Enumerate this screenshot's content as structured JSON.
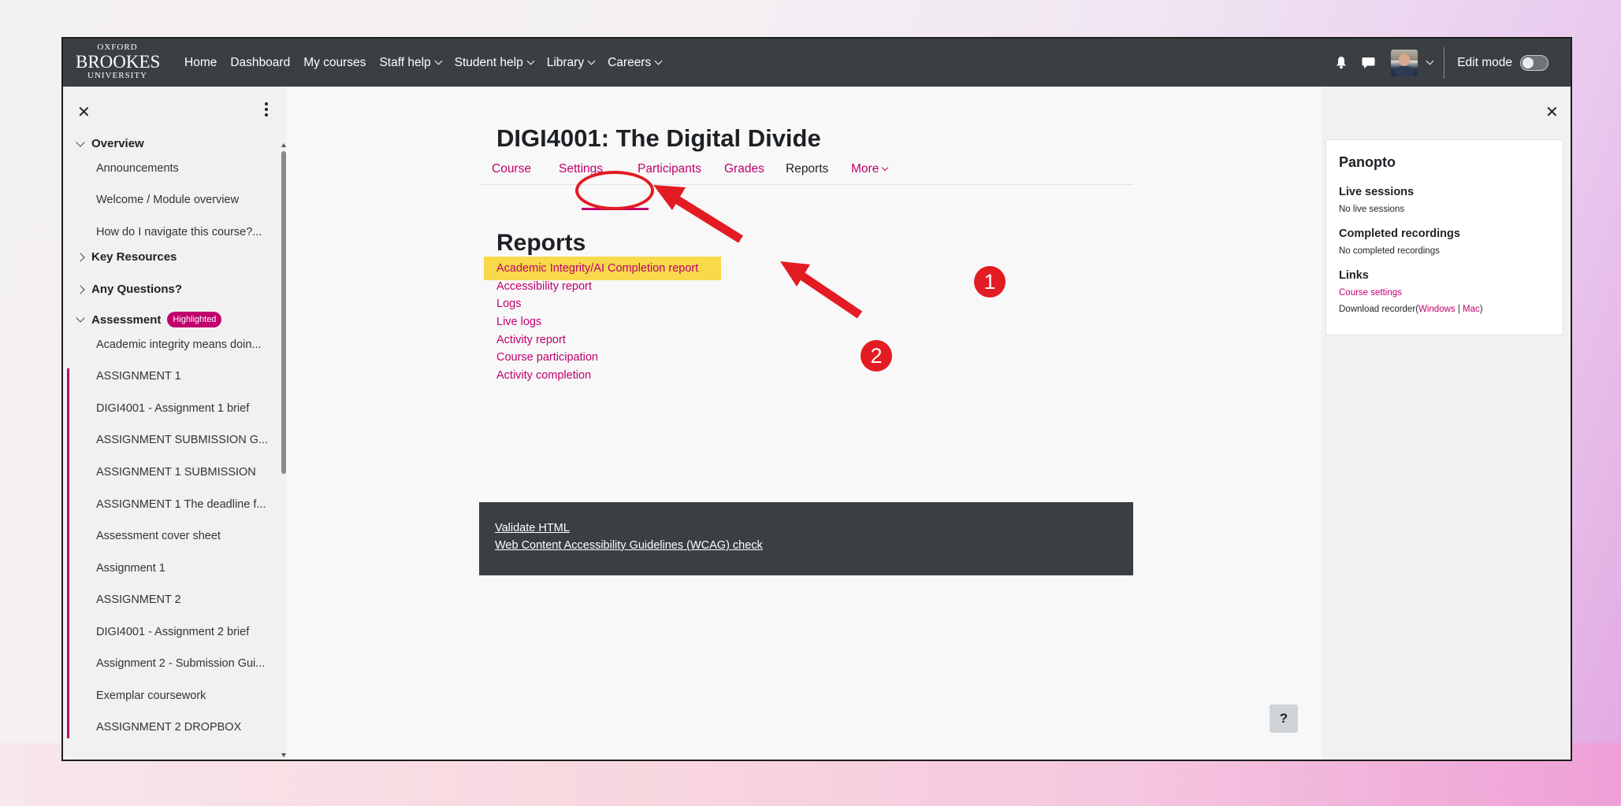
{
  "navbar": {
    "logo": {
      "line1": "OXFORD",
      "line2": "BROOKES",
      "line3": "UNIVERSITY"
    },
    "items": [
      {
        "label": "Home",
        "dropdown": false
      },
      {
        "label": "Dashboard",
        "dropdown": false
      },
      {
        "label": "My courses",
        "dropdown": false
      },
      {
        "label": "Staff help",
        "dropdown": true
      },
      {
        "label": "Student help",
        "dropdown": true
      },
      {
        "label": "Library",
        "dropdown": true
      },
      {
        "label": "Careers",
        "dropdown": true
      }
    ],
    "edit_mode_label": "Edit mode",
    "edit_mode_on": false
  },
  "course_index": {
    "sections": [
      {
        "title": "Overview",
        "expanded": true,
        "items": [
          "Announcements",
          "Welcome / Module overview",
          "How do I navigate this course?..."
        ]
      },
      {
        "title": "Key Resources",
        "expanded": false,
        "items": []
      },
      {
        "title": "Any Questions?",
        "expanded": false,
        "items": []
      },
      {
        "title": "Assessment",
        "expanded": true,
        "badge": "Highlighted",
        "items": [
          "Academic integrity means doin...",
          "ASSIGNMENT 1",
          "DIGI4001 - Assignment 1 brief",
          "ASSIGNMENT SUBMISSION G...",
          "ASSIGNMENT 1 SUBMISSION",
          "ASSIGNMENT 1 The deadline f...",
          "Assessment cover sheet",
          "Assignment 1",
          "ASSIGNMENT 2",
          "DIGI4001 - Assignment 2 brief",
          "Assignment 2 - Submission Gui...",
          "Exemplar coursework",
          "ASSIGNMENT 2 DROPBOX"
        ]
      }
    ]
  },
  "main": {
    "course_title": "DIGI4001: The Digital Divide",
    "tabs": [
      {
        "label": "Course"
      },
      {
        "label": "Settings"
      },
      {
        "label": "Participants"
      },
      {
        "label": "Grades"
      },
      {
        "label": "Reports",
        "active": true
      },
      {
        "label": "More",
        "dropdown": true
      }
    ],
    "page_title": "Reports",
    "report_links": [
      "Academic Integrity/AI Completion report",
      "Accessibility report",
      "Logs",
      "Live logs",
      "Activity report",
      "Course participation",
      "Activity completion"
    ],
    "footer_links": [
      "Validate HTML",
      "Web Content Accessibility Guidelines (WCAG) check"
    ],
    "help_label": "?"
  },
  "panopto": {
    "title": "Panopto",
    "live_heading": "Live sessions",
    "live_text": "No live sessions",
    "completed_heading": "Completed recordings",
    "completed_text": "No completed recordings",
    "links_heading": "Links",
    "course_settings": "Course settings",
    "download_prefix": "Download recorder(",
    "windows": "Windows",
    "separator": " | ",
    "mac": "Mac",
    "download_suffix": ")"
  },
  "annotations": {
    "marker1": "1",
    "marker2": "2"
  },
  "colors": {
    "accent": "#c0006e",
    "navbar": "#3a3f44",
    "highlight": "#f7d94a",
    "annotation_red": "#e31b23"
  }
}
